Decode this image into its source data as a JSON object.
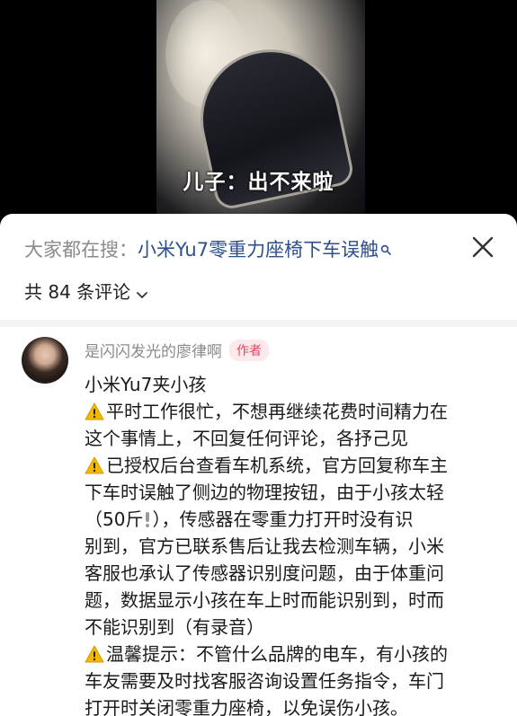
{
  "video": {
    "subtitle": "儿子：出不来啦"
  },
  "header": {
    "search_prefix": "大家都在搜：",
    "search_term": "小米Yu7零重力座椅下车误触",
    "comment_count": "共 84 条评论"
  },
  "comment": {
    "author": "是闪闪发光的廖律啊",
    "badge": "作者",
    "lines": [
      "小米Yu7夹小孩",
      "平时工作很忙，不想再继续花费时间精力在",
      "这个事情上，不回复任何评论，各抒己见",
      "已授权后台查看车机系统，官方回复称车主",
      "下车时误触了侧边的物理按钮，由于小孩太轻",
      "（50斤",
      "），传感器在零重力打开时没有识",
      "别到，官方已联系售后让我去检测车辆，小米",
      "客服也承认了传感器识别度问题，由于体重问",
      "题，数据显示小孩在车上时而能识别到，时而",
      "不能识别到（有录音）",
      "温馨提示：不管什么品牌的电车，有小孩的",
      "车友需要及时找客服咨询设置任务指令，车门",
      "打开时关闭零重力座椅，以免误伤小孩。"
    ]
  },
  "icons": {
    "warning": "warning-icon",
    "exclamation": "exclamation-icon",
    "search": "search-icon",
    "close": "close-icon",
    "chevron": "chevron-down-icon"
  },
  "colors": {
    "search_link": "#2d4f8c",
    "badge_text": "#e0465f",
    "badge_bg": "#fde8ec",
    "warning_yellow": "#f5b800"
  }
}
